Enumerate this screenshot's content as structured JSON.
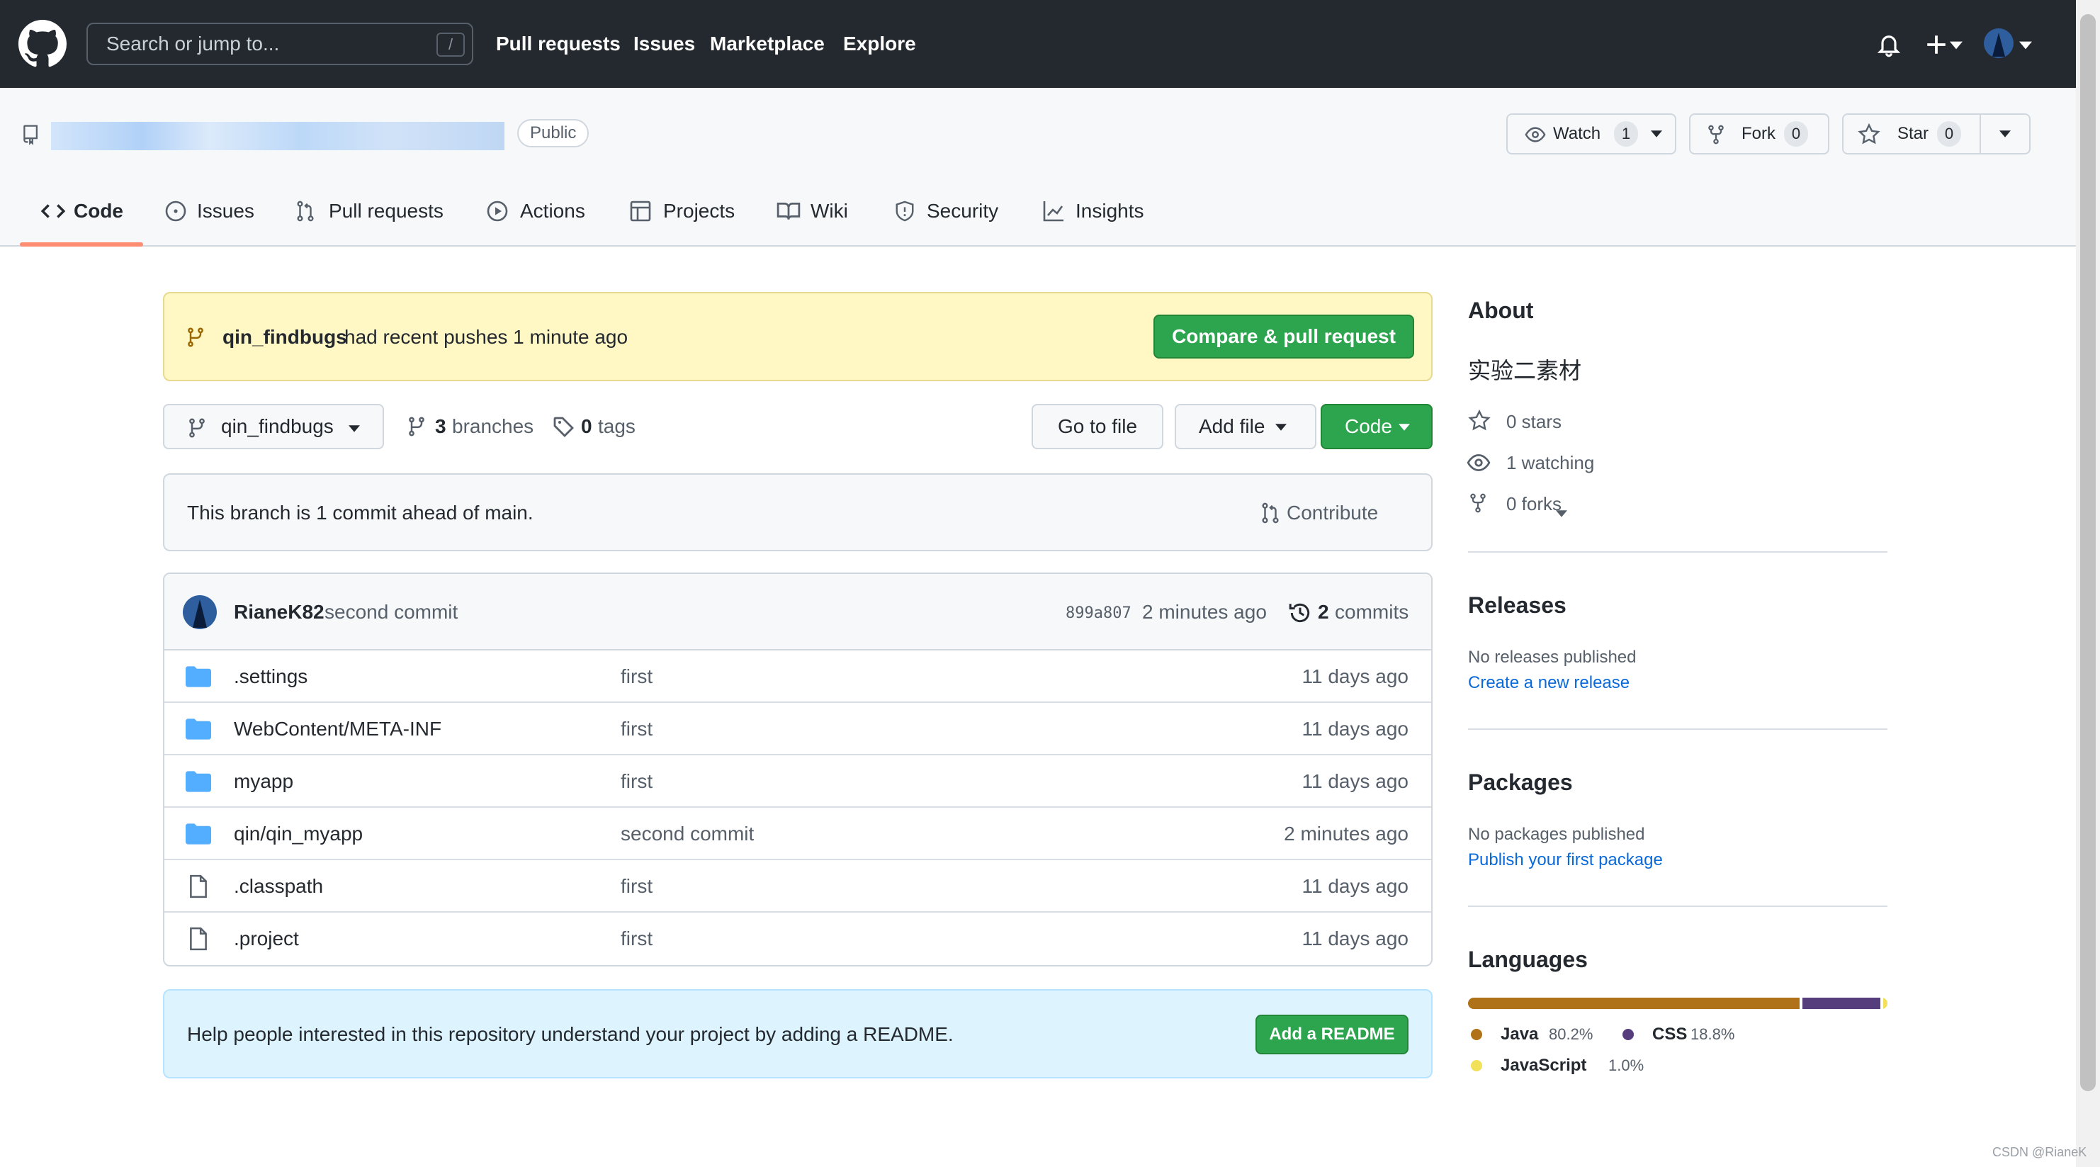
{
  "header": {
    "search_placeholder": "Search or jump to...",
    "search_shortcut": "/",
    "nav": [
      "Pull requests",
      "Issues",
      "Marketplace",
      "Explore"
    ]
  },
  "repo": {
    "visibility": "Public",
    "watch_label": "Watch",
    "watch_count": "1",
    "fork_label": "Fork",
    "fork_count": "0",
    "star_label": "Star",
    "star_count": "0"
  },
  "tabs": [
    "Code",
    "Issues",
    "Pull requests",
    "Actions",
    "Projects",
    "Wiki",
    "Security",
    "Insights"
  ],
  "push_banner": {
    "branch": "qin_findbugs",
    "message": "had recent pushes 1 minute ago",
    "button": "Compare & pull request"
  },
  "branch_bar": {
    "branch": "qin_findbugs",
    "branches_count": "3",
    "branches_label": "branches",
    "tags_count": "0",
    "tags_label": "tags",
    "go_to_file": "Go to file",
    "add_file": "Add file",
    "code": "Code"
  },
  "ahead": {
    "message": "This branch is 1 commit ahead of main.",
    "contribute": "Contribute"
  },
  "commit": {
    "author": "RianeK82",
    "message": "second commit",
    "sha": "899a807",
    "time": "2 minutes ago",
    "commits_count": "2",
    "commits_label": "commits"
  },
  "files": [
    {
      "name": ".settings",
      "type": "folder",
      "message": "first",
      "time": "11 days ago"
    },
    {
      "name": "WebContent/META-INF",
      "type": "folder",
      "message": "first",
      "time": "11 days ago"
    },
    {
      "name": "myapp",
      "type": "folder",
      "message": "first",
      "time": "11 days ago"
    },
    {
      "name": "qin/qin_myapp",
      "type": "folder",
      "message": "second commit",
      "time": "2 minutes ago"
    },
    {
      "name": ".classpath",
      "type": "file",
      "message": "first",
      "time": "11 days ago"
    },
    {
      "name": ".project",
      "type": "file",
      "message": "first",
      "time": "11 days ago"
    }
  ],
  "readme": {
    "message": "Help people interested in this repository understand your project by adding a README.",
    "button": "Add a README"
  },
  "about": {
    "title": "About",
    "description": "实验二素材",
    "stars": "0 stars",
    "watching": "1 watching",
    "forks": "0 forks"
  },
  "releases": {
    "title": "Releases",
    "empty": "No releases published",
    "link": "Create a new release"
  },
  "packages": {
    "title": "Packages",
    "empty": "No packages published",
    "link": "Publish your first package"
  },
  "languages": {
    "title": "Languages",
    "items": [
      {
        "name": "Java",
        "percent": "80.2%",
        "value": 80.2,
        "color": "#b07219"
      },
      {
        "name": "CSS",
        "percent": "18.8%",
        "value": 18.8,
        "color": "#563d7c"
      },
      {
        "name": "JavaScript",
        "percent": "1.0%",
        "value": 1.0,
        "color": "#f1e05a"
      }
    ]
  },
  "watermark": "CSDN @RianeK"
}
